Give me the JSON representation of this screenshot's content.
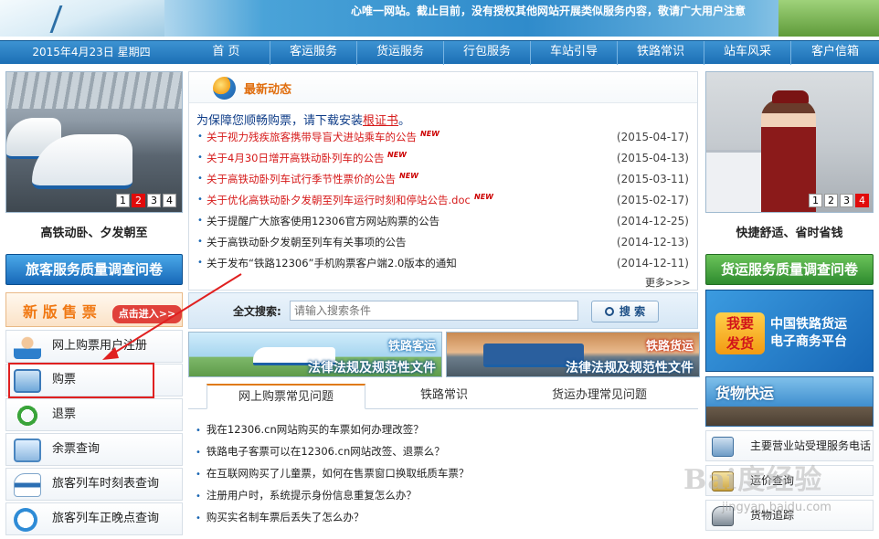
{
  "banner": {
    "ticker": "心唯一网站。截止目前，没有授权其他网站开展类似服务内容，敬请广大用户注意"
  },
  "navbar": {
    "date": "2015年4月23日 星期四",
    "items": [
      "首 页",
      "客运服务",
      "货运服务",
      "行包服务",
      "车站引导",
      "铁路常识",
      "站车风采",
      "客户信箱"
    ]
  },
  "left": {
    "pager": [
      "1",
      "2",
      "3",
      "4"
    ],
    "pager_active": "2",
    "caption": "高铁动卧、夕发朝至",
    "survey_label": "旅客服务质量调查问卷",
    "new_ticket": {
      "title": "新 版 售 票",
      "enter": "点击进入>>"
    },
    "menu": [
      {
        "label": "网上购票用户注册",
        "icon": "user-register-icon"
      },
      {
        "label": "购票",
        "icon": "buy-ticket-icon"
      },
      {
        "label": "退票",
        "icon": "refund-icon"
      },
      {
        "label": "余票查询",
        "icon": "remaining-tickets-icon"
      },
      {
        "label": "旅客列车时刻表查询",
        "icon": "train-schedule-icon"
      },
      {
        "label": "旅客列车正晚点查询",
        "icon": "clock-icon"
      }
    ]
  },
  "news": {
    "title": "最新动态",
    "notice_prefix": "为保障您顺畅购票，请下载安装",
    "notice_link": "根证书",
    "notice_suffix": "。",
    "new_badge": "NEW",
    "items": [
      {
        "text": "关于视力残疾旅客携带导盲犬进站乘车的公告",
        "date": "(2015-04-17)",
        "hot": true
      },
      {
        "text": "关于4月30日增开高铁动卧列车的公告",
        "date": "(2015-04-13)",
        "hot": true
      },
      {
        "text": "关于高铁动卧列车试行季节性票价的公告",
        "date": "(2015-03-11)",
        "hot": true
      },
      {
        "text": "关于优化高铁动卧夕发朝至列车运行时刻和停站公告.doc",
        "date": "(2015-02-17)",
        "hot": true
      },
      {
        "text": "关于提醒广大旅客使用12306官方网站购票的公告",
        "date": "(2014-12-25)",
        "hot": false
      },
      {
        "text": "关于高铁动卧夕发朝至列车有关事项的公告",
        "date": "(2014-12-13)",
        "hot": false
      },
      {
        "text": "关于发布“铁路12306”手机购票客户端2.0版本的通知",
        "date": "(2014-12-11)",
        "hot": false
      }
    ],
    "more": "更多>>>"
  },
  "search": {
    "label": "全文搜索:",
    "placeholder": "请输入搜索条件",
    "button": "搜 索"
  },
  "law": [
    {
      "name": "铁路客运",
      "sub": "法律法规及规范性文件"
    },
    {
      "name": "铁路货运",
      "sub": "法律法规及规范性文件"
    }
  ],
  "faq": {
    "tabs": [
      "网上购票常见问题",
      "铁路常识",
      "货运办理常见问题"
    ],
    "active": 0,
    "items": [
      "我在12306.cn网站购买的车票如何办理改签？",
      "铁路电子客票可以在12306.cn网站改签、退票么？",
      "在互联网购买了儿童票，如何在售票窗口换取纸质车票？",
      "注册用户时，系统提示身份信息重复怎么办？",
      "购买实名制车票后丢失了怎么办？"
    ]
  },
  "right": {
    "pager": [
      "1",
      "2",
      "3",
      "4"
    ],
    "pager_active": "4",
    "caption": "快捷舒适、省时省钱",
    "survey_label": "货运服务质量调查问卷",
    "promo_freight": {
      "badge_line1": "我要",
      "badge_line2": "发货",
      "line1": "中国铁路货运",
      "line2": "电子商务平台"
    },
    "promo_express": "货物快运",
    "menu": [
      {
        "label": "主要营业站受理服务电话",
        "icon": "phone-icon"
      },
      {
        "label": "运价查询",
        "icon": "freight-rate-icon"
      },
      {
        "label": "货物追踪",
        "icon": "cargo-tracking-icon"
      }
    ]
  },
  "watermark": {
    "logo": "Bai度经验",
    "url": "jingyan.baidu.com"
  },
  "colors": {
    "nav": "#1c6fb5",
    "accent_orange": "#e06d0d",
    "hot_red": "#d61a1a",
    "highlight": "#e02020"
  }
}
